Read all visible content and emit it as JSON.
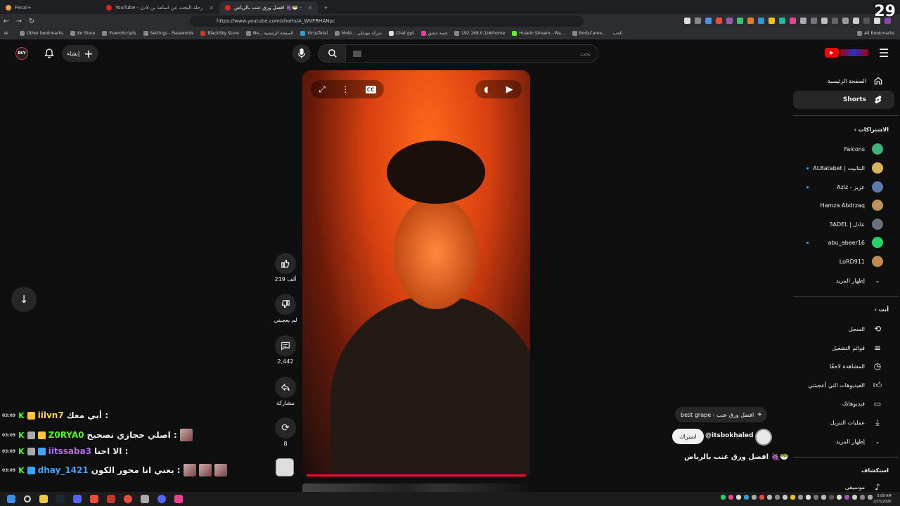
{
  "browser": {
    "tabs": [
      {
        "label": "Fecal+"
      },
      {
        "label": "YouTube - رحلة البحث عن اسامة بن لادن"
      },
      {
        "label": "افضل ورق عنب بالرياض 🍇🥗 -"
      }
    ],
    "url": "https://www.youtube.com/shorts/A_WVFRHANpc",
    "bookmarks": [
      "Other bookmarks",
      "Ko Store",
      "FivemScripts",
      "Settings - Passwords",
      "BlackSky Store",
      "Ne... الصفحة الرئيسية",
      "VirusTotal",
      "Mobi... شركة موبايلي",
      "Chat gpt",
      "قصة عشق",
      "192.168.0.1/#/home",
      "Husein Stream - Wa...",
      "BodyCame...",
      "الحب"
    ],
    "all_bookmarks": "All Bookmarks"
  },
  "header": {
    "create_label": "إنشاء",
    "channel_badge": "BKY",
    "search_placeholder": "بحث"
  },
  "sidebar": {
    "main": [
      {
        "label": "الصفحة الرئيسية",
        "icon": "home-icon"
      },
      {
        "label": "Shorts",
        "icon": "shorts-icon",
        "active": true
      }
    ],
    "subscriptions_title": "الاشتراكات",
    "subscriptions": [
      {
        "label": "Falcons",
        "color": "#3fb37f",
        "dot": false
      },
      {
        "label": "ALBatabet | البتابيت",
        "color": "#d9b45a",
        "dot": true
      },
      {
        "label": "Aziz - عزيز",
        "color": "#5a7aa8",
        "dot": true
      },
      {
        "label": "Hamza Abdrzaq",
        "color": "#b9925e",
        "dot": false
      },
      {
        "label": "3ADEL | عادل",
        "color": "#6b6f7a",
        "dot": false
      },
      {
        "label": "abu_abeer16",
        "color": "#25d366",
        "dot": true
      },
      {
        "label": "LoRD911",
        "color": "#c08a55",
        "dot": false
      }
    ],
    "show_more_1": "إظهار المزيد",
    "you_title": "أنت",
    "you_items": [
      {
        "label": "السجل",
        "icon": "history-icon"
      },
      {
        "label": "قوائم التشغيل",
        "icon": "playlist-icon"
      },
      {
        "label": "المشاهدة لاحقًا",
        "icon": "clock-icon"
      },
      {
        "label": "الفيديوهات التي أعجبتني",
        "icon": "like-icon"
      },
      {
        "label": "فيديوهاتك",
        "icon": "your-videos-icon"
      },
      {
        "label": "عمليات التنزيل",
        "icon": "download-icon"
      }
    ],
    "show_more_2": "إظهار المزيد",
    "explore_title": "استكشاف",
    "explore_items": [
      {
        "label": "موسيقى",
        "icon": "music-icon"
      }
    ]
  },
  "actions": {
    "likes": "219 ألف",
    "dislike_label": "لم يعجبني",
    "comments": "2,442",
    "share_label": "مشاركة",
    "remix_count": "8"
  },
  "video_info": {
    "location": "best grape - افضل ورق عنب",
    "channel": "@itsbokhaled",
    "subscribe": "اشتراك",
    "title": "افضل ورق عنب بالرياض 🍇🥗"
  },
  "chat": [
    {
      "time": "03:09",
      "user": "iilvn7",
      "user_color": "#ffd54a",
      "message": "أبي معك :"
    },
    {
      "time": "03:09",
      "user": "Z0RYA0",
      "user_color": "#53fc18",
      "message": "اصلي حجازي تصحيح :"
    },
    {
      "time": "03:09",
      "user": "iitssaba3",
      "user_color": "#b46cff",
      "message": "الا احنا :"
    },
    {
      "time": "03:09",
      "user": "dhay_1421",
      "user_color": "#3ea6ff",
      "message": "يعني انا محور الكون :"
    }
  ],
  "system": {
    "clock_time": "3:09 AM",
    "clock_date": "2/15/2026",
    "overlay_number": "29"
  }
}
